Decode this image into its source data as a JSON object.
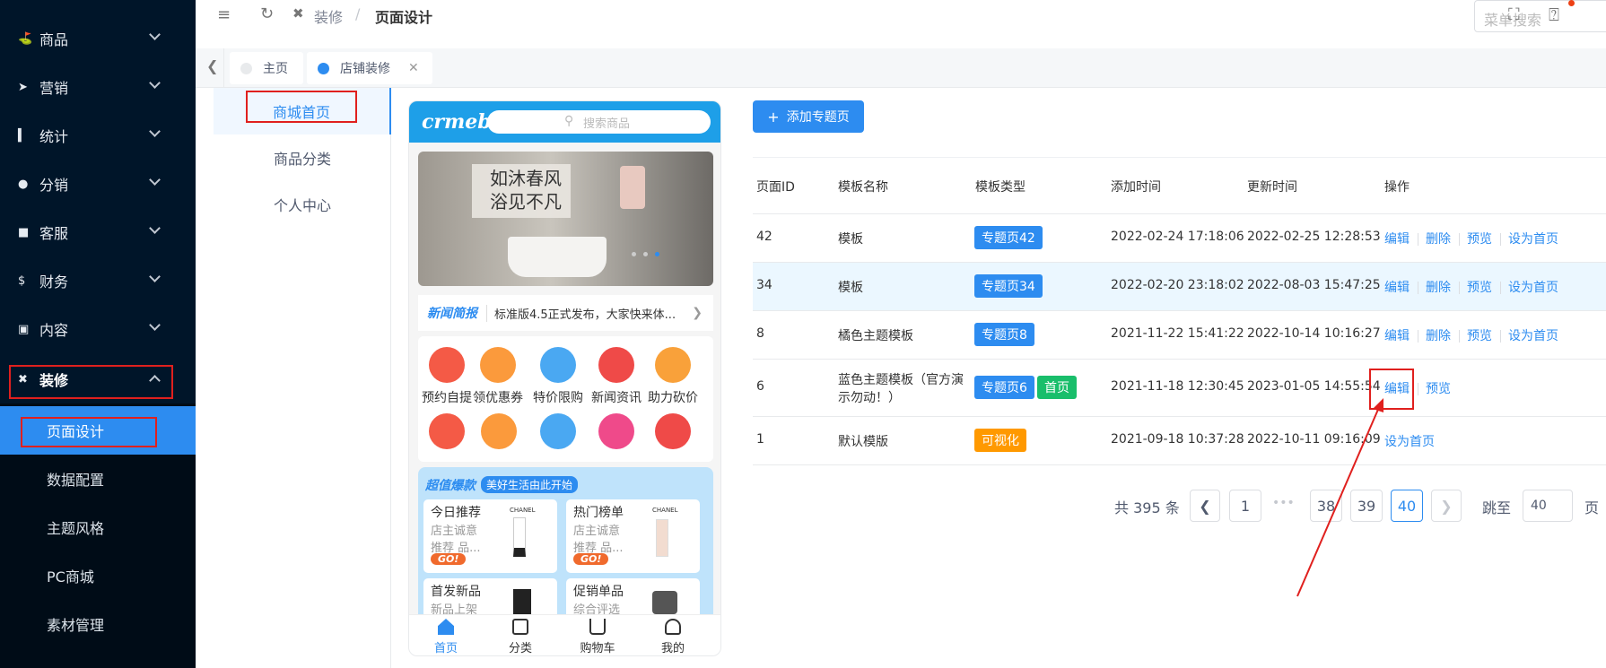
{
  "sidebar": {
    "menu": [
      {
        "label": "商品",
        "icon": "shop-icon"
      },
      {
        "label": "营销",
        "icon": "paper-plane-icon"
      },
      {
        "label": "统计",
        "icon": "bar-chart-icon"
      },
      {
        "label": "分销",
        "icon": "users-icon"
      },
      {
        "label": "客服",
        "icon": "chat-icon"
      },
      {
        "label": "财务",
        "icon": "dollar-icon"
      },
      {
        "label": "内容",
        "icon": "book-icon"
      },
      {
        "label": "装修",
        "icon": "tools-icon"
      }
    ],
    "submenu": [
      "页面设计",
      "数据配置",
      "主题风格",
      "PC商城",
      "素材管理"
    ]
  },
  "header": {
    "breadcrumb_parent": "装修",
    "breadcrumb_sep": "/",
    "breadcrumb_current": "页面设计",
    "search_placeholder": "菜单搜索"
  },
  "tabs": [
    {
      "label": "主页"
    },
    {
      "label": "店铺装修"
    }
  ],
  "left_nav": [
    "商城首页",
    "商品分类",
    "个人中心"
  ],
  "phone": {
    "logo": "crmeb",
    "search_placeholder": "搜索商品",
    "banner_line1": "如沐春风",
    "banner_line2": "浴见不凡",
    "news_tag": "新闻简报",
    "news_text": "标准版4.5正式发布，大家快来体...",
    "icons": [
      "预约自提",
      "领优惠券",
      "特价限购",
      "新闻资讯",
      "助力砍价"
    ],
    "promo_title": "超值爆款",
    "promo_sub": "美好生活由此开始",
    "cards": [
      {
        "title": "今日推荐",
        "l1": "店主诚意",
        "l2": "推荐 品...",
        "brand": "CHANEL"
      },
      {
        "title": "热门榜单",
        "l1": "店主诚意",
        "l2": "推荐 品...",
        "brand": "CHANEL"
      },
      {
        "title": "首发新品",
        "l1": "新品上架",
        "l2": "",
        "brand": ""
      },
      {
        "title": "促销单品",
        "l1": "综合评选",
        "l2": "",
        "brand": ""
      }
    ],
    "go_label": "GO!",
    "footer": [
      "首页",
      "分类",
      "购物车",
      "我的"
    ]
  },
  "main": {
    "add_button": "添加专题页",
    "columns": [
      "页面ID",
      "模板名称",
      "模板类型",
      "添加时间",
      "更新时间",
      "操作"
    ],
    "rows": [
      {
        "id": "42",
        "name": "模板",
        "tag": "专题页42",
        "tag2": "",
        "added": "2022-02-24 17:18:06",
        "updated": "2022-02-25 12:28:53"
      },
      {
        "id": "34",
        "name": "模板",
        "tag": "专题页34",
        "tag2": "",
        "added": "2022-02-20 23:18:02",
        "updated": "2022-08-03 15:47:25"
      },
      {
        "id": "8",
        "name": "橘色主题模板",
        "tag": "专题页8",
        "tag2": "",
        "added": "2021-11-22 15:41:22",
        "updated": "2022-10-14 10:16:27"
      },
      {
        "id": "6",
        "name_l1": "蓝色主题模板（官方演",
        "name_l2": "示勿动！）",
        "tag": "专题页6",
        "tag2": "首页",
        "added": "2021-11-18 12:30:45",
        "updated": "2023-01-05 14:55:54"
      },
      {
        "id": "1",
        "name": "默认模版",
        "tag": "可视化",
        "tag2": "",
        "added": "2021-09-18 10:37:28",
        "updated": "2022-10-11 09:16:09"
      }
    ],
    "actions": {
      "edit": "编辑",
      "delete": "删除",
      "preview": "预览",
      "set_home": "设为首页"
    },
    "pagination": {
      "total": "共 395 条",
      "pages": [
        "1",
        "•••",
        "38",
        "39",
        "40"
      ],
      "jump_label": "跳至",
      "jump_value": "40",
      "suffix": "页"
    }
  },
  "colors": {
    "primary": "#2d8cf0",
    "sidebar": "#001529",
    "highlight": "#e0201e",
    "tag_green": "#19be6b",
    "tag_orange": "#ff9900"
  }
}
